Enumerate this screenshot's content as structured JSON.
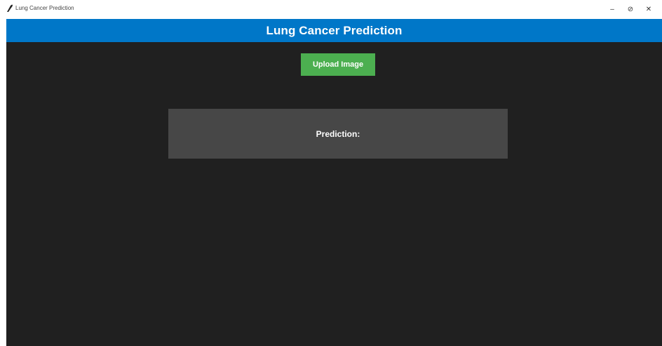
{
  "window": {
    "title": "Lung Cancer Prediction",
    "controls": {
      "minimize": "–",
      "restore": "⊘",
      "close": "✕"
    }
  },
  "header": {
    "title": "Lung Cancer Prediction"
  },
  "main": {
    "upload_label": "Upload Image",
    "prediction_label": "Prediction:"
  },
  "colors": {
    "header_bg": "#0077c8",
    "body_bg": "#202020",
    "button_bg": "#4caf50",
    "panel_bg": "#474747"
  },
  "icons": {
    "app": "feather-icon"
  }
}
